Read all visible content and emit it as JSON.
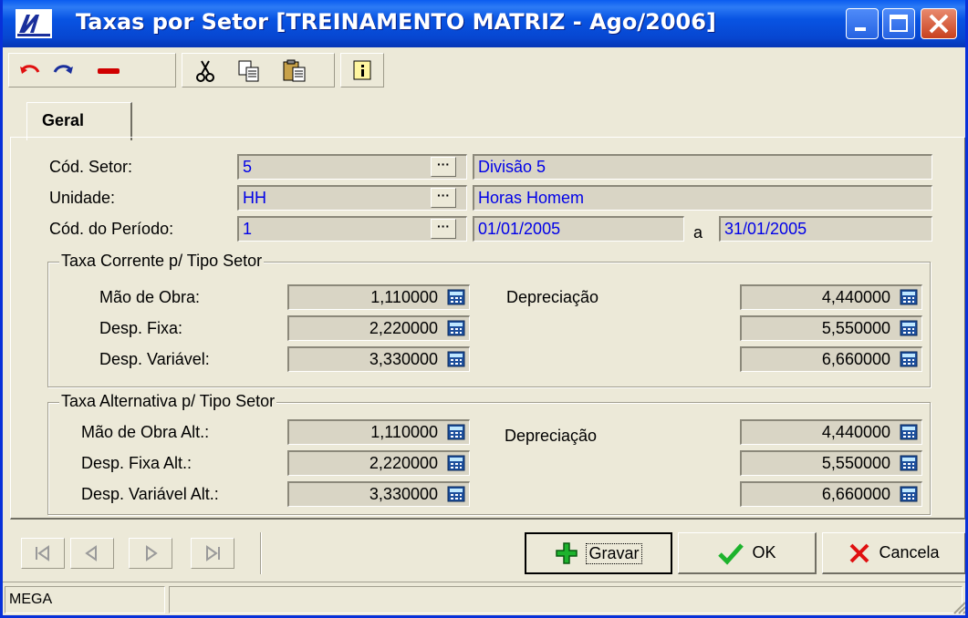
{
  "window": {
    "title": "Taxas por Setor [TREINAMENTO MATRIZ - Ago/2006]"
  },
  "tabs": [
    {
      "label": "Geral"
    }
  ],
  "form": {
    "cod_setor": {
      "label": "Cód. Setor:",
      "value": "5",
      "description": "Divisão 5"
    },
    "unidade": {
      "label": "Unidade:",
      "value": "HH",
      "description": "Horas Homem"
    },
    "cod_periodo": {
      "label": "Cód. do Período:",
      "value": "1",
      "date_from": "01/01/2005",
      "separator": "a",
      "date_to": "31/01/2005"
    }
  },
  "taxa_corrente": {
    "title": "Taxa Corrente p/ Tipo Setor",
    "mao_obra": {
      "label": "Mão de Obra:",
      "value": "1,110000"
    },
    "desp_fixa": {
      "label": "Desp. Fixa:",
      "value": "2,220000"
    },
    "desp_variavel": {
      "label": "Desp. Variável:",
      "value": "3,330000"
    },
    "depreciacao": {
      "label": "Depreciação",
      "values": [
        "4,440000",
        "5,550000",
        "6,660000"
      ]
    }
  },
  "taxa_alternativa": {
    "title": "Taxa Alternativa p/ Tipo Setor",
    "mao_obra": {
      "label": "Mão de Obra Alt.:",
      "value": "1,110000"
    },
    "desp_fixa": {
      "label": "Desp. Fixa Alt.:",
      "value": "2,220000"
    },
    "desp_variavel": {
      "label": "Desp. Variável Alt.:",
      "value": "3,330000"
    },
    "depreciacao": {
      "label": "Depreciação",
      "values": [
        "4,440000",
        "5,550000",
        "6,660000"
      ]
    }
  },
  "actions": {
    "save": "Gravar",
    "ok": "OK",
    "cancel": "Cancela"
  },
  "status": {
    "company": "MEGA"
  },
  "colors": {
    "titlebar": "#0854e3",
    "field_text": "#0000e8",
    "background": "#ece9d8"
  }
}
